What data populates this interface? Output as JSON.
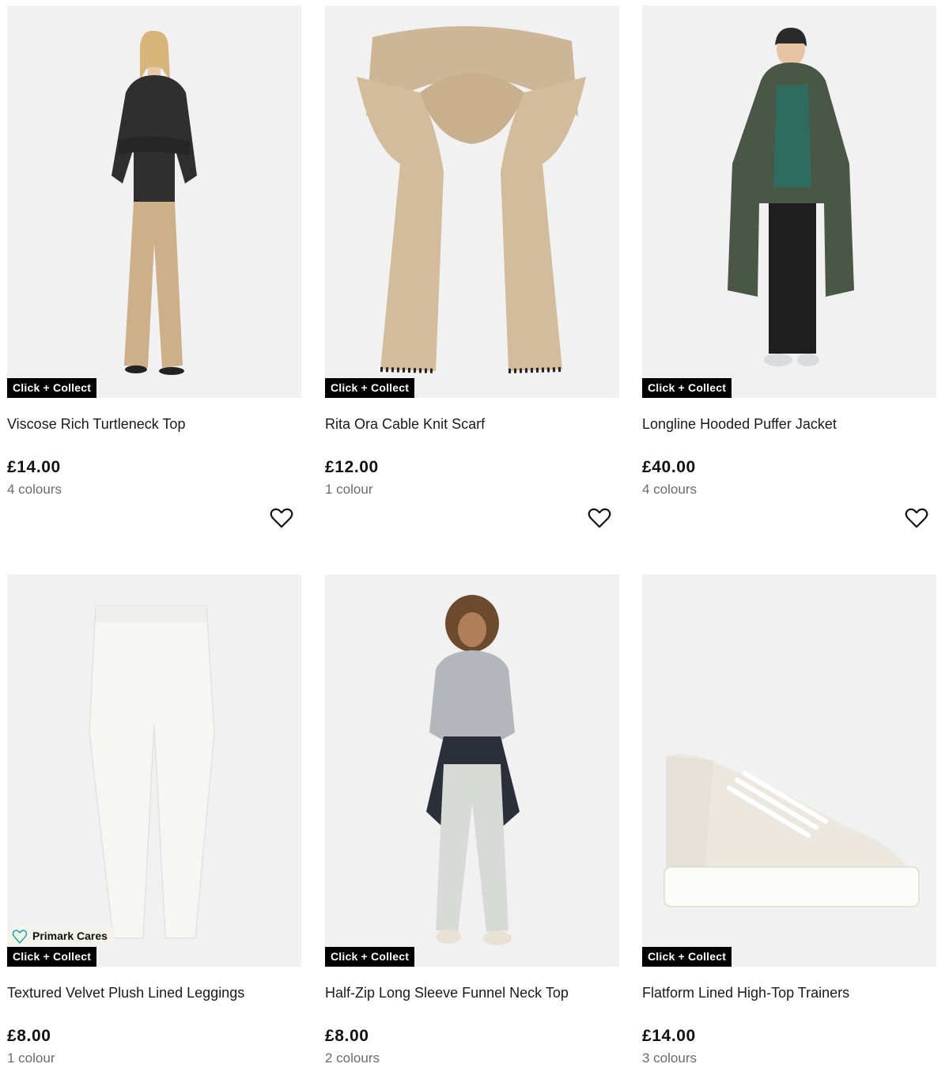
{
  "products": [
    {
      "badge_collect": "Click + Collect",
      "badge_cares": "",
      "title": "Viscose Rich Turtleneck Top",
      "price": "£14.00",
      "colours": "4 colours",
      "wishlist_icon": "heart-outline-icon"
    },
    {
      "badge_collect": "Click + Collect",
      "badge_cares": "",
      "title": "Rita Ora Cable Knit Scarf",
      "price": "£12.00",
      "colours": "1 colour",
      "wishlist_icon": "heart-outline-icon"
    },
    {
      "badge_collect": "Click + Collect",
      "badge_cares": "",
      "title": "Longline Hooded Puffer Jacket",
      "price": "£40.00",
      "colours": "4 colours",
      "wishlist_icon": "heart-outline-icon"
    },
    {
      "badge_collect": "Click + Collect",
      "badge_cares": "Primark Cares",
      "title": "Textured Velvet Plush Lined Leggings",
      "price": "£8.00",
      "colours": "1 colour",
      "wishlist_icon": "heart-outline-icon"
    },
    {
      "badge_collect": "Click + Collect",
      "badge_cares": "",
      "title": "Half-Zip Long Sleeve Funnel Neck Top",
      "price": "£8.00",
      "colours": "2 colours",
      "wishlist_icon": "heart-outline-icon"
    },
    {
      "badge_collect": "Click + Collect",
      "badge_cares": "",
      "title": "Flatform Lined High-Top Trainers",
      "price": "£14.00",
      "colours": "3 colours",
      "wishlist_icon": "heart-outline-icon"
    }
  ],
  "colors": {
    "image_bg": "#f1f1f1",
    "badge_bg": "#000000",
    "cares_bg": "#f3f3ec",
    "cares_icon": "#2aa7a0",
    "muted_text": "#6b6b6b"
  }
}
